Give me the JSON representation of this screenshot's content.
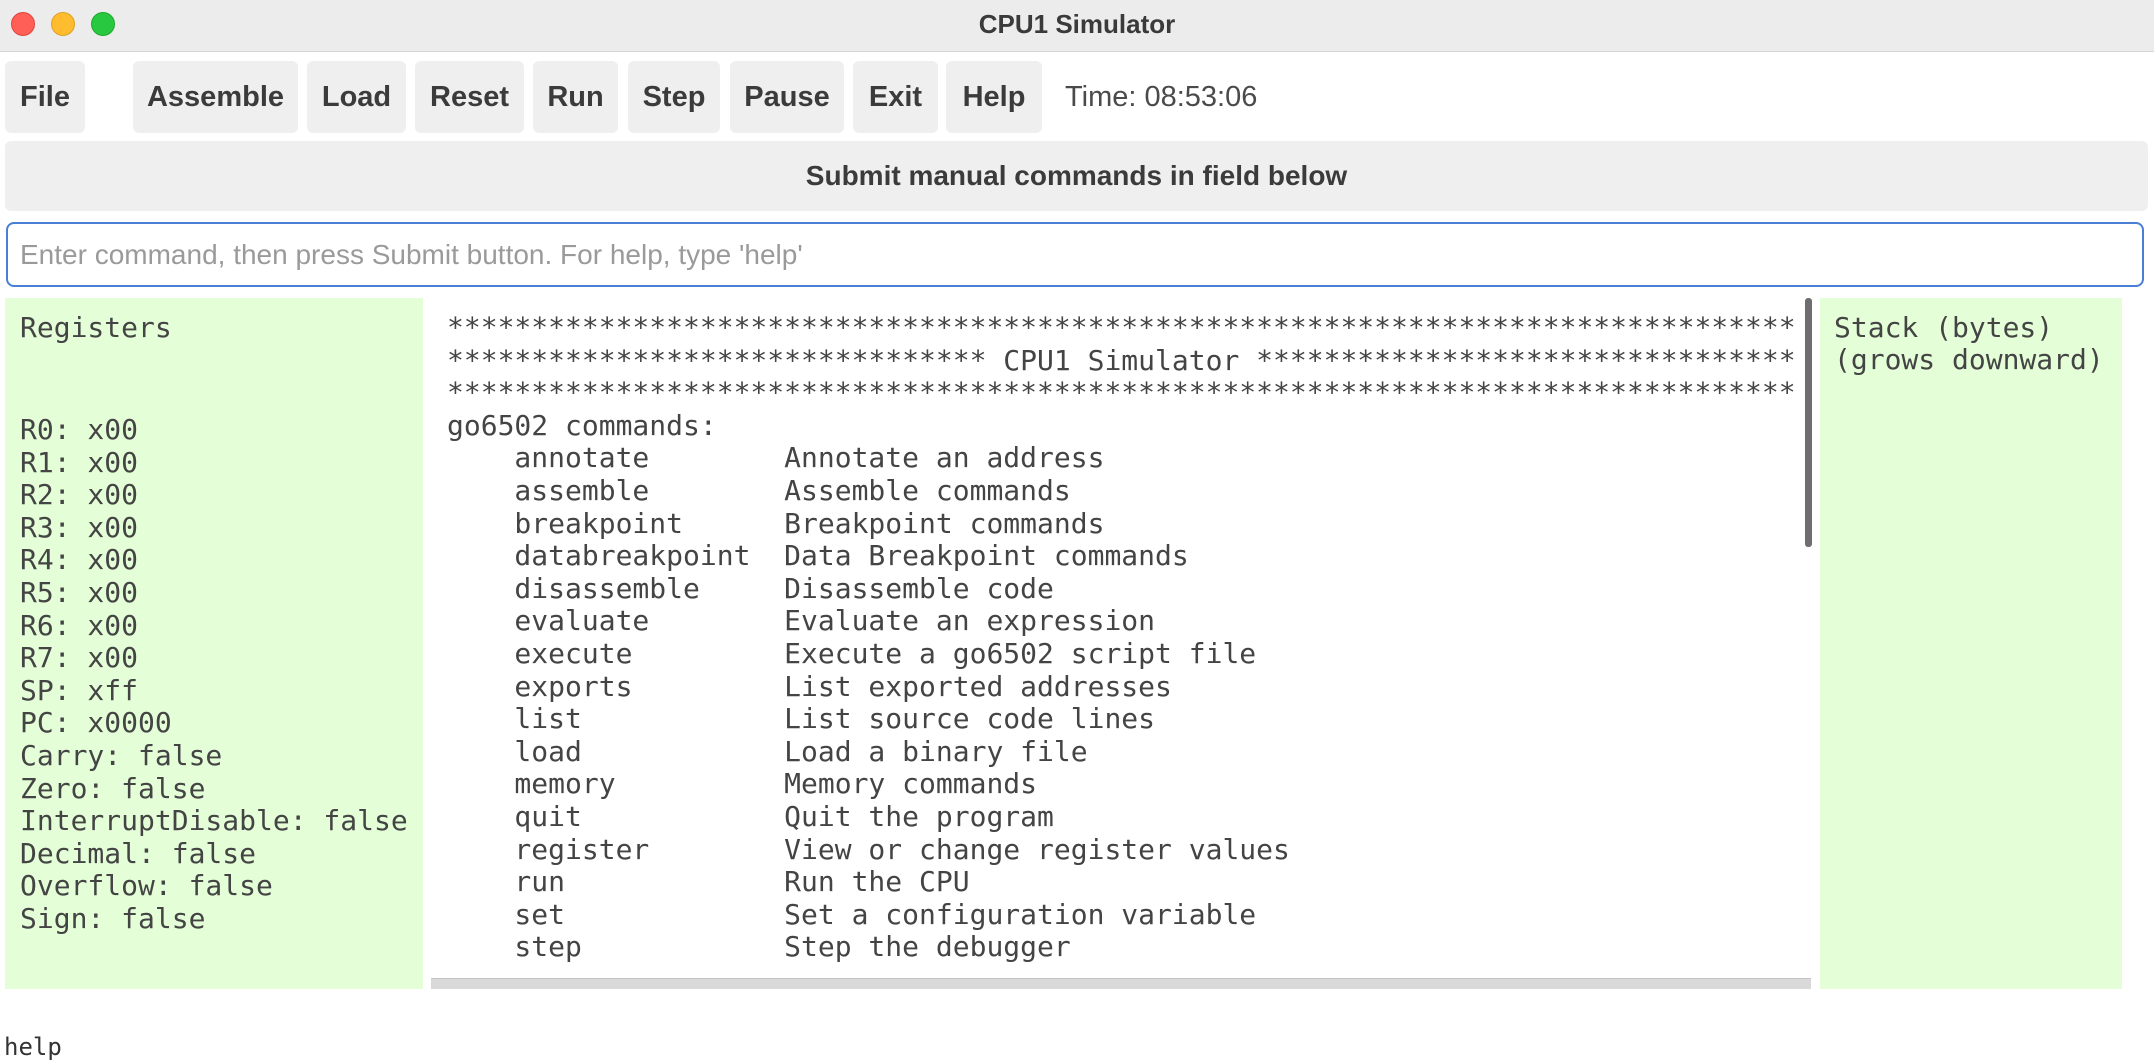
{
  "window": {
    "title": "CPU1 Simulator"
  },
  "toolbar": {
    "file": "File",
    "assemble": "Assemble",
    "load": "Load",
    "reset": "Reset",
    "run": "Run",
    "step": "Step",
    "pause": "Pause",
    "exit": "Exit",
    "help": "Help",
    "time": "Time: 08:53:06"
  },
  "banner": "Submit manual commands in field below",
  "command": {
    "value": "",
    "placeholder": "Enter command, then press Submit button. For help, type 'help'"
  },
  "registers": {
    "title": "Registers",
    "lines": [
      "R0: x00",
      "R1: x00",
      "R2: x00",
      "R3: x00",
      "R4: x00",
      "R5: x00",
      "R6: x00",
      "R7: x00",
      "SP: xff",
      "PC: x0000",
      "Carry: false",
      "Zero: false",
      "InterruptDisable: false",
      "Decimal: false",
      "Overflow: false",
      "Sign: false"
    ]
  },
  "console": {
    "lines": [
      "********************************************************************************",
      "******************************** CPU1 Simulator ********************************",
      "********************************************************************************",
      "go6502 commands:",
      "    annotate        Annotate an address",
      "    assemble        Assemble commands",
      "    breakpoint      Breakpoint commands",
      "    databreakpoint  Data Breakpoint commands",
      "    disassemble     Disassemble code",
      "    evaluate        Evaluate an expression",
      "    execute         Execute a go6502 script file",
      "    exports         List exported addresses",
      "    list            List source code lines",
      "    load            Load a binary file",
      "    memory          Memory commands",
      "    quit            Quit the program",
      "    register        View or change register values",
      "    run             Run the CPU",
      "    set             Set a configuration variable",
      "    step            Step the debugger"
    ]
  },
  "stack": {
    "lines": [
      "Stack (bytes)",
      "(grows downward)"
    ]
  },
  "status": "help"
}
